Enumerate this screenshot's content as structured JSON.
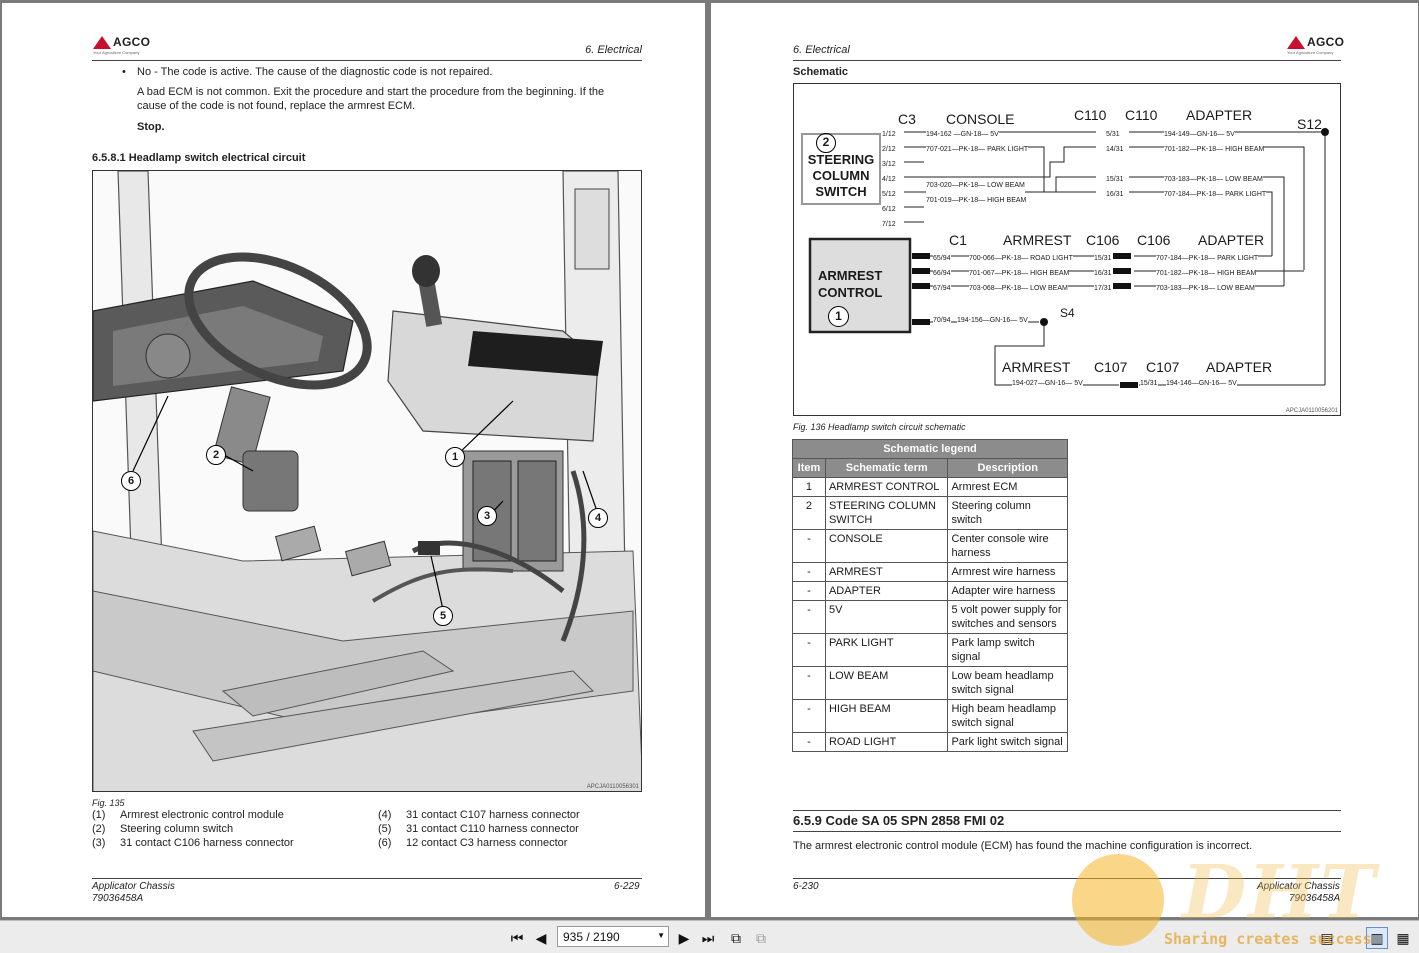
{
  "left_page": {
    "logo_word": "AGCO",
    "logo_tagline": "Your Agriculture Company",
    "section_header": "6. Electrical",
    "bullet_text": "No - The code is active. The cause of the diagnostic code is not repaired.",
    "para1_line1": "A bad ECM is not common. Exit the procedure and start the procedure from the beginning. If the",
    "para1_line2": "cause of the code is not found, replace the armrest ECM.",
    "stop": "Stop.",
    "subsection_title": "6.5.8.1  Headlamp switch electrical circuit",
    "figure_code": "APCJA0110056301",
    "figure_caption": "Fig. 135",
    "callouts": [
      "1",
      "2",
      "3",
      "4",
      "5",
      "6"
    ],
    "legend": [
      {
        "num": "(1)",
        "label": "Armrest electronic control module"
      },
      {
        "num": "(2)",
        "label": "Steering column switch"
      },
      {
        "num": "(3)",
        "label": "31 contact C106 harness connector"
      },
      {
        "num": "(4)",
        "label": "31 contact C107 harness connector"
      },
      {
        "num": "(5)",
        "label": "31 contact C110 harness connector"
      },
      {
        "num": "(6)",
        "label": "12 contact C3 harness connector"
      }
    ],
    "footer_title": "Applicator Chassis",
    "footer_docnum": "79036458A",
    "footer_page": "6-229"
  },
  "right_page": {
    "logo_word": "AGCO",
    "logo_tagline": "Your Agriculture Company",
    "section_header": "6. Electrical",
    "schematic_heading": "Schematic",
    "schematic": {
      "steering_switch_label": [
        "STEERING",
        "COLUMN",
        "SWITCH"
      ],
      "steering_switch_num": "2",
      "armrest_label": [
        "ARMREST",
        "CONTROL"
      ],
      "armrest_num": "1",
      "top_headers": [
        "C3",
        "CONSOLE",
        "C110",
        "C110",
        "ADAPTER",
        "S12"
      ],
      "c3_pins": [
        "1/12",
        "2/12",
        "3/12",
        "4/12",
        "5/12",
        "6/12",
        "7/12"
      ],
      "top_wires": [
        "194-162 —GN-18— 5V",
        "707-021—PK-18— PARK LIGHT",
        "",
        "703-020—PK-18— LOW BEAM",
        "701-019—PK-18— HIGH BEAM"
      ],
      "c110_pins": [
        "5/31",
        "14/31",
        "15/31",
        "16/31"
      ],
      "c110_wires": [
        "194-149—GN-16— 5V",
        "701-182—PK-18— HIGH BEAM",
        "703-183—PK-18— LOW BEAM",
        "707-184—PK-18— PARK LIGHT"
      ],
      "mid_headers": [
        "C1",
        "ARMREST",
        "C106",
        "C106",
        "ADAPTER"
      ],
      "c1_pins": [
        "65/94",
        "66/94",
        "67/94",
        "70/94"
      ],
      "mid_wires": [
        "700-066—PK-18— ROAD LIGHT",
        "701-067—PK-18— HIGH BEAM",
        "703-068—PK-18— LOW BEAM",
        "194-156—GN-16— 5V"
      ],
      "c106_pins": [
        "15/31",
        "16/31",
        "17/31"
      ],
      "c106_wires": [
        "707-184—PK-18— PARK LIGHT",
        "701-182—PK-18— HIGH BEAM",
        "703-183—PK-18— LOW BEAM"
      ],
      "s4_label": "S4",
      "bottom_headers": [
        "ARMREST",
        "C107",
        "C107",
        "ADAPTER"
      ],
      "bottom_wire_left": "194-027—GN-16— 5V",
      "c107_pin": "15/31",
      "bottom_wire_right": "194-146—GN-16— 5V",
      "code": "APCJA0110056201"
    },
    "figure_caption": "Fig. 136  Headlamp switch circuit schematic",
    "legend_table": {
      "title": "Schematic legend",
      "headers": [
        "Item",
        "Schematic term",
        "Description"
      ],
      "rows": [
        {
          "item": "1",
          "term": "ARMREST CONTROL",
          "desc": "Armrest ECM"
        },
        {
          "item": "2",
          "term": "STEERING COLUMN SWITCH",
          "desc": "Steering column switch"
        },
        {
          "item": "-",
          "term": "CONSOLE",
          "desc": "Center console wire harness"
        },
        {
          "item": "-",
          "term": "ARMREST",
          "desc": "Armrest wire harness"
        },
        {
          "item": "-",
          "term": "ADAPTER",
          "desc": "Adapter wire harness"
        },
        {
          "item": "-",
          "term": "5V",
          "desc": "5 volt power supply for switches and sensors"
        },
        {
          "item": "-",
          "term": "PARK LIGHT",
          "desc": "Park lamp switch signal"
        },
        {
          "item": "-",
          "term": "LOW BEAM",
          "desc": "Low beam headlamp switch signal"
        },
        {
          "item": "-",
          "term": "HIGH BEAM",
          "desc": "High beam headlamp switch signal"
        },
        {
          "item": "-",
          "term": "ROAD LIGHT",
          "desc": "Park light switch signal"
        }
      ]
    },
    "section_title": "6.5.9  Code SA 05 SPN 2858 FMI 02",
    "section_body": "The armrest electronic control module (ECM) has found the machine configuration is incorrect.",
    "footer_page": "6-230",
    "footer_title": "Applicator Chassis",
    "footer_docnum": "79036458A"
  },
  "toolbar": {
    "page_indicator": "935 / 2190"
  },
  "watermark": {
    "big_text": "DHT",
    "slogan": "Sharing creates success"
  }
}
